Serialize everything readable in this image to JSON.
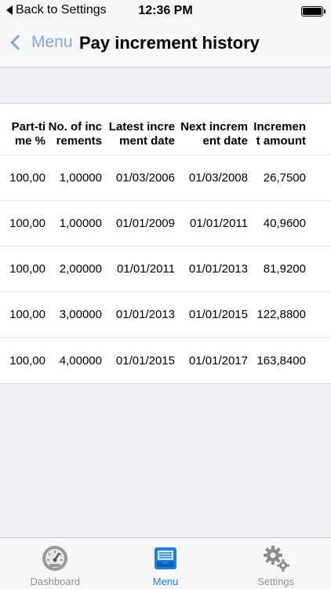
{
  "status_bar": {
    "back_label": "Back to Settings",
    "time": "12:36 PM"
  },
  "nav": {
    "back_label": "Menu",
    "title": "Pay increment history"
  },
  "table": {
    "headers": [
      "Part-time %",
      "No. of increments",
      "Latest increment date",
      "Next increment date",
      "Increment amount"
    ],
    "rows": [
      [
        "100,00",
        "1,00000",
        "01/03/2006",
        "01/03/2008",
        "26,7500"
      ],
      [
        "100,00",
        "1,00000",
        "01/01/2009",
        "01/01/2011",
        "40,9600"
      ],
      [
        "100,00",
        "2,00000",
        "01/01/2011",
        "01/01/2013",
        "81,9200"
      ],
      [
        "100,00",
        "3,00000",
        "01/01/2013",
        "01/01/2015",
        "122,8800"
      ],
      [
        "100,00",
        "4,00000",
        "01/01/2015",
        "01/01/2017",
        "163,8400"
      ]
    ]
  },
  "tabs": [
    {
      "label": "Dashboard",
      "icon": "gauge-icon"
    },
    {
      "label": "Menu",
      "icon": "inbox-tray-icon",
      "active": true
    },
    {
      "label": "Settings",
      "icon": "gears-icon"
    }
  ],
  "colors": {
    "accent": "#1a80e6",
    "nav_back": "#8aa7d9",
    "tab_inactive": "#929292"
  }
}
